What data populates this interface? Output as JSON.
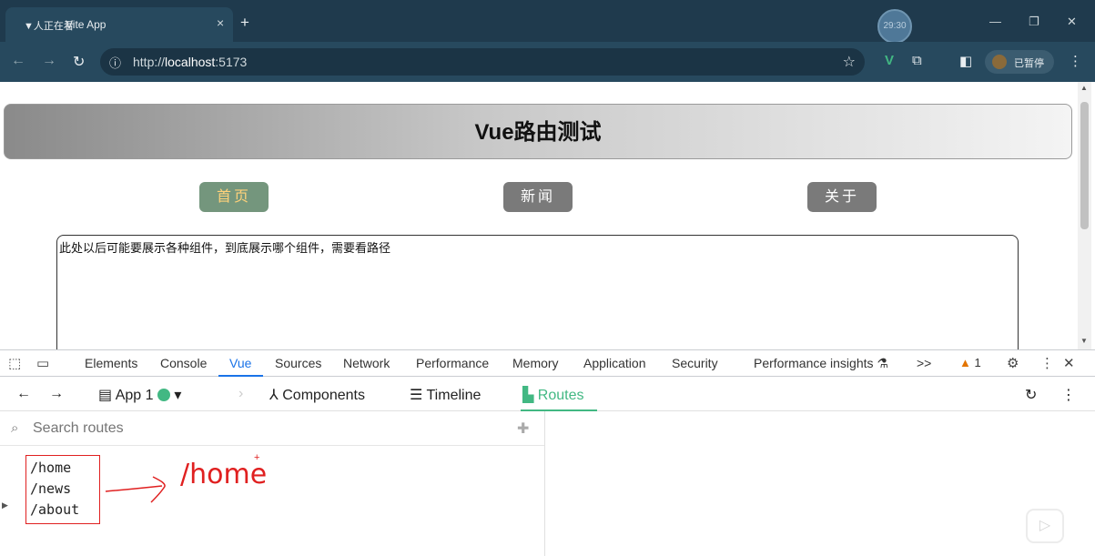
{
  "browser": {
    "tab_prefix": "▼人正在看",
    "tab_title": "Vite App",
    "tab_close": "×",
    "new_tab": "+",
    "timer": "29:30",
    "url_scheme": "http://",
    "url_host": "localhost",
    "url_port": ":5173",
    "profile_label": "已暂停"
  },
  "page": {
    "title": "Vue路由测试",
    "nav": [
      {
        "label": "首页",
        "active": true
      },
      {
        "label": "新闻",
        "active": false
      },
      {
        "label": "关于",
        "active": false
      }
    ],
    "content_text": "此处以后可能要展示各种组件，到底展示哪个组件，需要看路径"
  },
  "devtools": {
    "tabs": [
      "Elements",
      "Console",
      "Vue",
      "Sources",
      "Network",
      "Performance",
      "Memory",
      "Application",
      "Security",
      "Performance insights"
    ],
    "active_tab": "Vue",
    "more": ">>",
    "warning_count": "1"
  },
  "vue_devtools": {
    "app_label": "App 1",
    "components_label": "Components",
    "timeline_label": "Timeline",
    "routes_label": "Routes",
    "search_placeholder": "Search routes",
    "routes": [
      "/home",
      "/news",
      "/about"
    ],
    "annotation": "/home"
  },
  "colors": {
    "active_nav_bg": "#74967d",
    "active_nav_text": "#ffd27a",
    "vue_green": "#42b883",
    "annotation_red": "#e02020"
  }
}
